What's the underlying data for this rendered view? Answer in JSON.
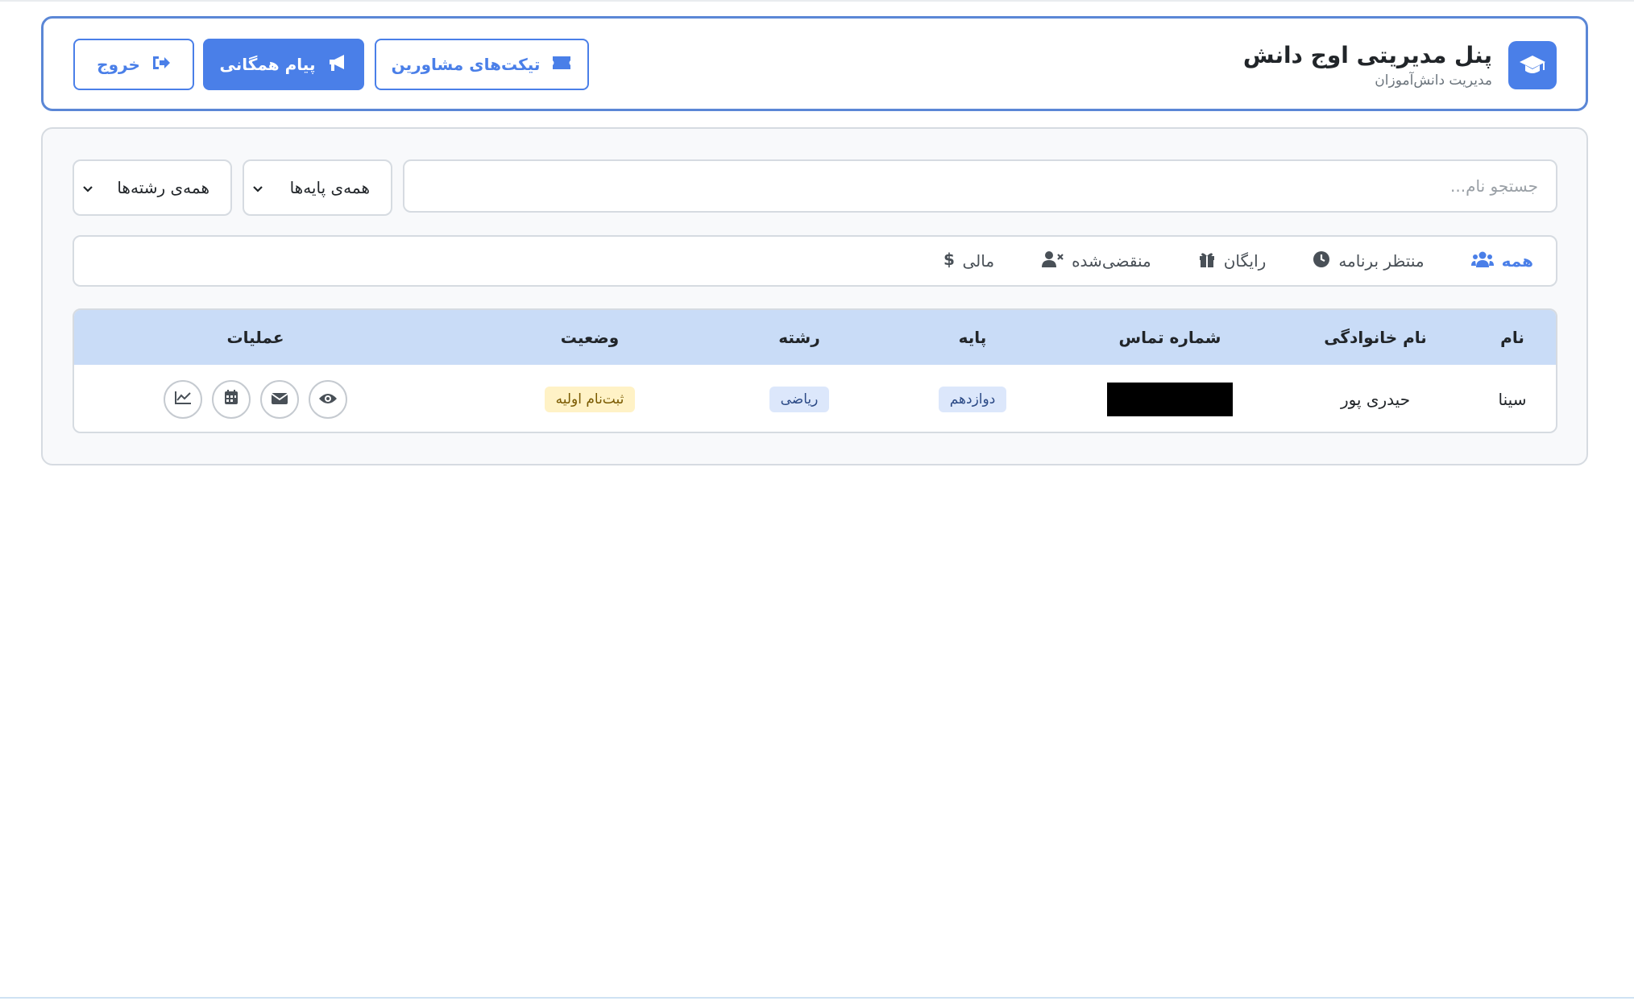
{
  "header": {
    "title": "پنل مدیریتی اوج دانش",
    "subtitle": "مدیریت دانش‌آموزان",
    "brand_icon": "graduation-cap-icon",
    "buttons": {
      "tickets": "تیکت‌های مشاورین",
      "broadcast": "پیام همگانی",
      "logout": "خروج"
    }
  },
  "filters": {
    "search_placeholder": "جستجو نام...",
    "search_value": "",
    "grade_selected": "همه‌ی پایه‌ها",
    "field_selected": "همه‌ی رشته‌ها"
  },
  "tabs": [
    {
      "label": "همه",
      "icon": "users-icon",
      "active": true
    },
    {
      "label": "منتظر برنامه",
      "icon": "clock-icon",
      "active": false
    },
    {
      "label": "رایگان",
      "icon": "gift-icon",
      "active": false
    },
    {
      "label": "منقضی‌شده",
      "icon": "user-times-icon",
      "active": false
    },
    {
      "label": "مالی",
      "icon": "dollar-icon",
      "active": false
    }
  ],
  "table": {
    "headers": {
      "first_name": "نام",
      "last_name": "نام خانوادگی",
      "phone": "شماره تماس",
      "grade": "پایه",
      "field": "رشته",
      "status": "وضعیت",
      "actions": "عملیات"
    },
    "rows": [
      {
        "first_name": "سینا",
        "last_name": "حیدری پور",
        "grade": "دوازدهم",
        "field": "ریاضی",
        "status": "ثبت‌نام اولیه"
      }
    ]
  },
  "colors": {
    "accent": "#4a7fe8",
    "table_header": "#c9dcf7",
    "status_badge": "#fff2c6"
  }
}
